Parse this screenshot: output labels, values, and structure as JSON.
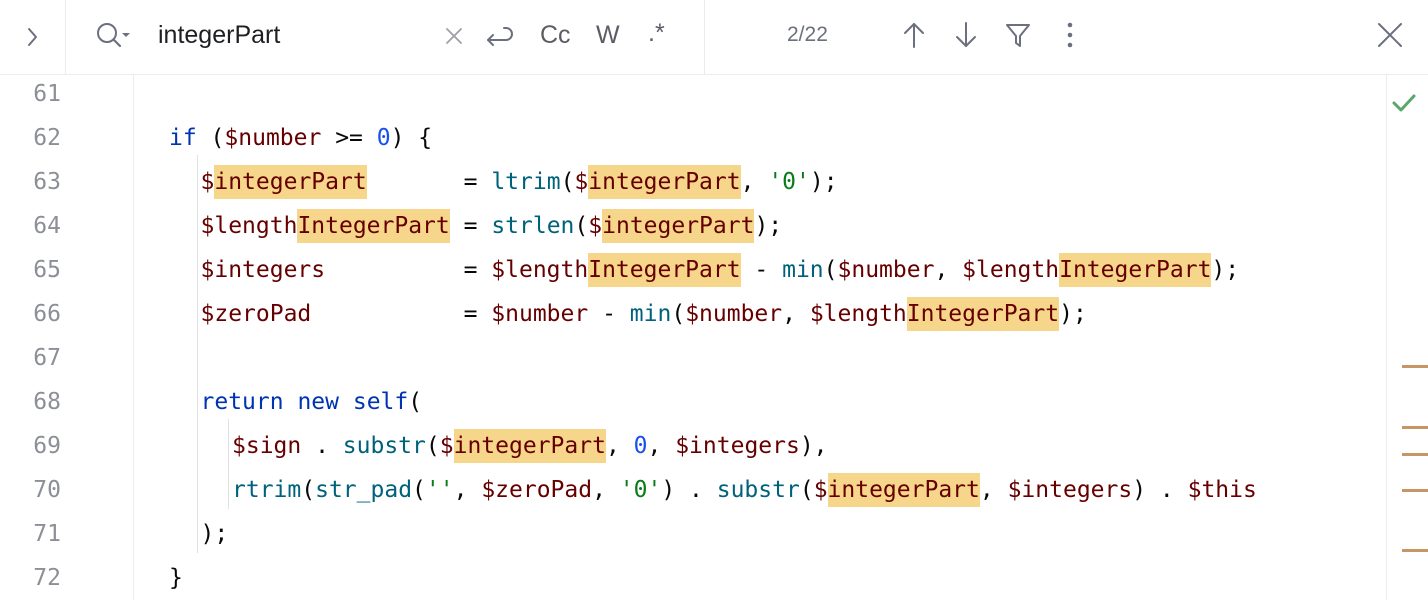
{
  "find": {
    "query": "integerPart",
    "case_label": "Cc",
    "words_label": "W",
    "regex_label": ".*",
    "match_count": "2/22"
  },
  "editor": {
    "lines": [
      {
        "n": "61",
        "indent": 0,
        "tokens": []
      },
      {
        "n": "62",
        "indent": 1,
        "tokens": [
          {
            "t": "if",
            "c": "kw"
          },
          {
            "t": " ("
          },
          {
            "t": "$number",
            "c": "var"
          },
          {
            "t": " >= "
          },
          {
            "t": "0",
            "c": "num"
          },
          {
            "t": ") {"
          }
        ]
      },
      {
        "n": "63",
        "indent": 2,
        "tokens": [
          {
            "t": "$",
            "c": "var"
          },
          {
            "t": "integerPart",
            "c": "var hl"
          },
          {
            "t": "       = "
          },
          {
            "t": "ltrim",
            "c": "fn"
          },
          {
            "t": "("
          },
          {
            "t": "$",
            "c": "var"
          },
          {
            "t": "integerPart",
            "c": "var hl"
          },
          {
            "t": ", "
          },
          {
            "t": "'0'",
            "c": "str"
          },
          {
            "t": ");"
          }
        ]
      },
      {
        "n": "64",
        "indent": 2,
        "tokens": [
          {
            "t": "$length",
            "c": "var"
          },
          {
            "t": "IntegerPart",
            "c": "var hl"
          },
          {
            "t": " = "
          },
          {
            "t": "strlen",
            "c": "fn"
          },
          {
            "t": "("
          },
          {
            "t": "$",
            "c": "var"
          },
          {
            "t": "integerPart",
            "c": "var hl"
          },
          {
            "t": ");"
          }
        ]
      },
      {
        "n": "65",
        "indent": 2,
        "tokens": [
          {
            "t": "$integers",
            "c": "var"
          },
          {
            "t": "          = "
          },
          {
            "t": "$length",
            "c": "var"
          },
          {
            "t": "IntegerPart",
            "c": "var hl"
          },
          {
            "t": " - "
          },
          {
            "t": "min",
            "c": "fn"
          },
          {
            "t": "("
          },
          {
            "t": "$number",
            "c": "var"
          },
          {
            "t": ", "
          },
          {
            "t": "$length",
            "c": "var"
          },
          {
            "t": "IntegerPart",
            "c": "var hl"
          },
          {
            "t": ");"
          }
        ]
      },
      {
        "n": "66",
        "indent": 2,
        "tokens": [
          {
            "t": "$zeroPad",
            "c": "var"
          },
          {
            "t": "           = "
          },
          {
            "t": "$number",
            "c": "var"
          },
          {
            "t": " - "
          },
          {
            "t": "min",
            "c": "fn"
          },
          {
            "t": "("
          },
          {
            "t": "$number",
            "c": "var"
          },
          {
            "t": ", "
          },
          {
            "t": "$length",
            "c": "var"
          },
          {
            "t": "IntegerPart",
            "c": "var hl"
          },
          {
            "t": ");"
          }
        ]
      },
      {
        "n": "67",
        "indent": 0,
        "tokens": []
      },
      {
        "n": "68",
        "indent": 2,
        "tokens": [
          {
            "t": "return",
            "c": "kw"
          },
          {
            "t": " "
          },
          {
            "t": "new",
            "c": "kw"
          },
          {
            "t": " "
          },
          {
            "t": "self",
            "c": "kw"
          },
          {
            "t": "("
          }
        ]
      },
      {
        "n": "69",
        "indent": 3,
        "tokens": [
          {
            "t": "$sign",
            "c": "var"
          },
          {
            "t": " . "
          },
          {
            "t": "substr",
            "c": "fn"
          },
          {
            "t": "("
          },
          {
            "t": "$",
            "c": "var"
          },
          {
            "t": "integerPart",
            "c": "var hl"
          },
          {
            "t": ", "
          },
          {
            "t": "0",
            "c": "num"
          },
          {
            "t": ", "
          },
          {
            "t": "$integers",
            "c": "var"
          },
          {
            "t": "),"
          }
        ]
      },
      {
        "n": "70",
        "indent": 3,
        "tokens": [
          {
            "t": "rtrim",
            "c": "fn"
          },
          {
            "t": "("
          },
          {
            "t": "str_pad",
            "c": "fn"
          },
          {
            "t": "("
          },
          {
            "t": "''",
            "c": "str"
          },
          {
            "t": ", "
          },
          {
            "t": "$zeroPad",
            "c": "var"
          },
          {
            "t": ", "
          },
          {
            "t": "'0'",
            "c": "str"
          },
          {
            "t": ") . "
          },
          {
            "t": "substr",
            "c": "fn"
          },
          {
            "t": "("
          },
          {
            "t": "$",
            "c": "var"
          },
          {
            "t": "integerPart",
            "c": "var hl"
          },
          {
            "t": ", "
          },
          {
            "t": "$integers",
            "c": "var"
          },
          {
            "t": ") . "
          },
          {
            "t": "$this",
            "c": "var"
          }
        ]
      },
      {
        "n": "71",
        "indent": 2,
        "tokens": [
          {
            "t": ");"
          }
        ]
      },
      {
        "n": "72",
        "indent": 1,
        "tokens": [
          {
            "t": "}"
          }
        ]
      }
    ]
  },
  "colors": {
    "match_highlight": "#f5d68a",
    "keyword": "#0033b3",
    "variable": "#660000",
    "function": "#00627a",
    "string": "#067d17",
    "number": "#1750eb",
    "inspection_ok": "#59a869",
    "scroll_marker": "#c79665"
  }
}
